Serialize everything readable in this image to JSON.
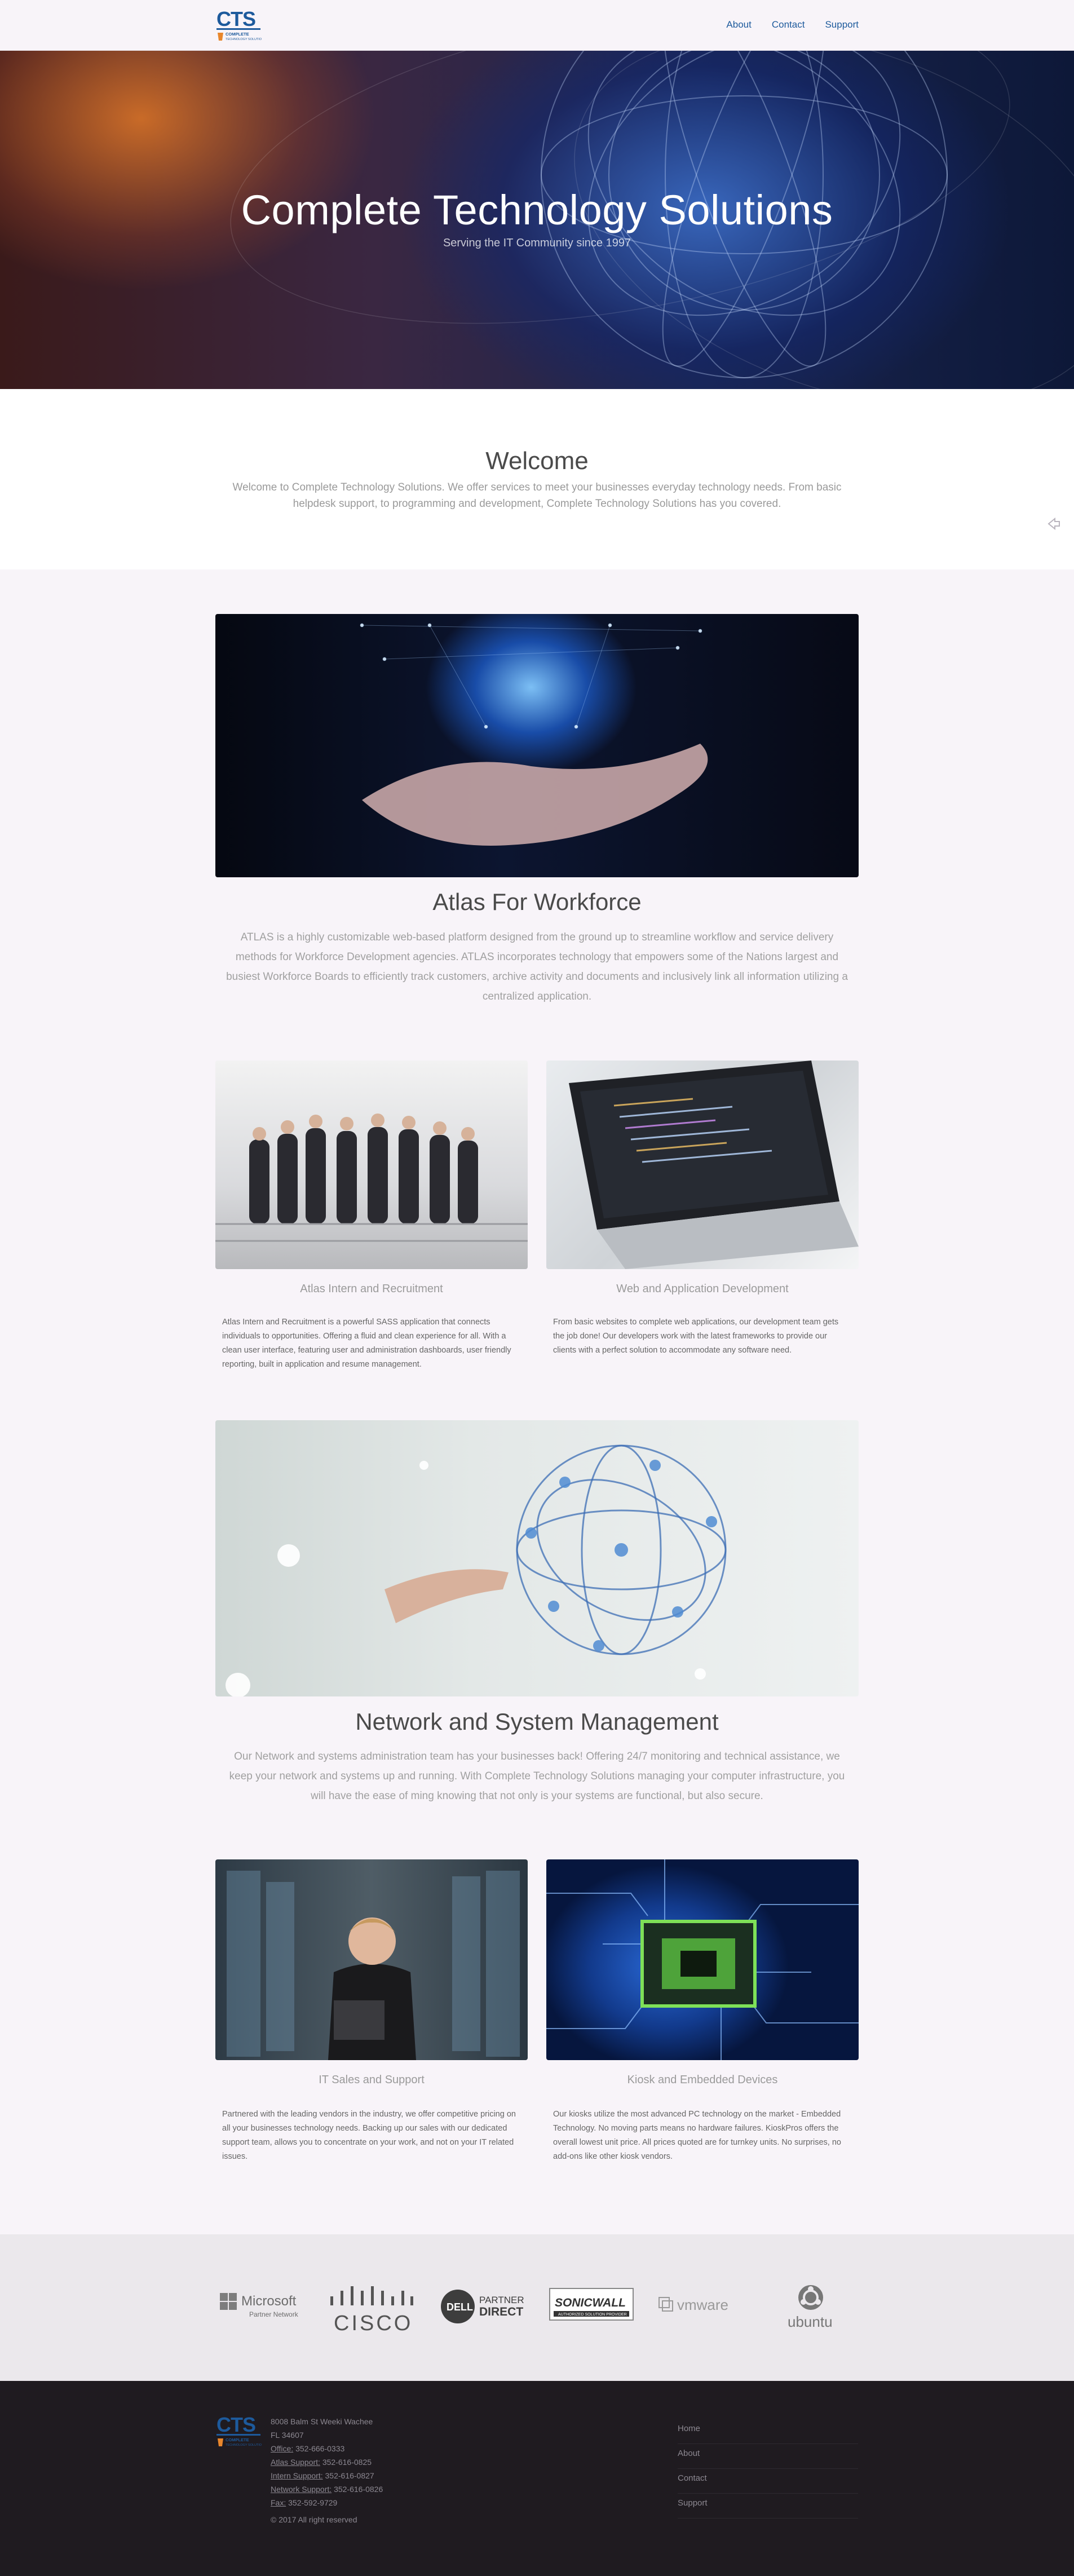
{
  "nav": {
    "logo_text": "CTS",
    "logo_sub": "COMPLETE TECHNOLOGY SOLUTIONS",
    "links": [
      "About",
      "Contact",
      "Support"
    ]
  },
  "hero": {
    "title": "Complete Technology Solutions",
    "subtitle": "Serving the IT Community since 1997"
  },
  "welcome": {
    "title": "Welcome",
    "text": "Welcome to Complete Technology Solutions. We offer services to meet your businesses everyday technology needs. From basic helpdesk support, to programming and development, Complete Technology Solutions has you covered."
  },
  "atlas": {
    "title": "Atlas For Workforce",
    "text": "ATLAS is a highly customizable web-based platform designed from the ground up to streamline workflow and service delivery methods for Workforce Development agencies. ATLAS incorporates technology that empowers some of the Nations largest and busiest Workforce Boards to efficiently track customers, archive activity and documents and inclusively link all information utilizing a centralized application."
  },
  "cards_row1": [
    {
      "title": "Atlas Intern and Recruitment",
      "text": "Atlas Intern and Recruitment is a powerful SASS application that connects individuals to opportunities. Offering a fluid and clean experience for all. With a clean user interface, featuring user and administration dashboards, user friendly reporting, built in application and resume management."
    },
    {
      "title": "Web and Application Development",
      "text": "From basic websites to complete web applications, our development team gets the job done! Our developers work with the latest frameworks to provide our clients with a perfect solution to accommodate any software need."
    }
  ],
  "network": {
    "title": "Network and System Management",
    "text": "Our Network and systems administration team has your businesses back! Offering 24/7 monitoring and technical assistance, we keep your network and systems up and running. With Complete Technology Solutions managing your computer infrastructure, you will have the ease of ming knowing that not only is your systems are functional, but also secure."
  },
  "cards_row2": [
    {
      "title": "IT Sales and Support",
      "text": "Partnered with the leading vendors in the industry, we offer competitive pricing on all your businesses technology needs. Backing up our sales with our dedicated support team, allows you to concentrate on your work, and not on your IT related issues."
    },
    {
      "title": "Kiosk and Embedded Devices",
      "text": "Our kiosks utilize the most advanced PC technology on the market - Embedded Technology. No moving parts means no hardware failures. KioskPros offers the overall lowest unit price. All prices quoted are for turnkey units. No surprises, no add-ons like other kiosk vendors."
    }
  ],
  "partners": {
    "microsoft": "Microsoft",
    "microsoft_sub": "Partner Network",
    "cisco": "CISCO",
    "dell": "DELL",
    "dell_partner": "PARTNER",
    "dell_direct": "DIRECT",
    "sonicwall": "SONICWALL",
    "sonicwall_sub": "AUTHORIZED SOLUTION PROVIDER",
    "vmware": "vmware",
    "ubuntu": "ubuntu"
  },
  "footer": {
    "address1": "8008 Balm St Weeki Wachee",
    "address2": "FL 34607",
    "office_label": "Office:",
    "office": "352-666-0333",
    "atlas_label": "Atlas Support:",
    "atlas": "352-616-0825",
    "intern_label": "Intern Support:",
    "intern": "352-616-0827",
    "network_label": "Network Support:",
    "network": "352-616-0826",
    "fax_label": "Fax:",
    "fax": "352-592-9729",
    "copyright": "© 2017 All right reserved",
    "links": [
      "Home",
      "About",
      "Contact",
      "Support"
    ]
  }
}
